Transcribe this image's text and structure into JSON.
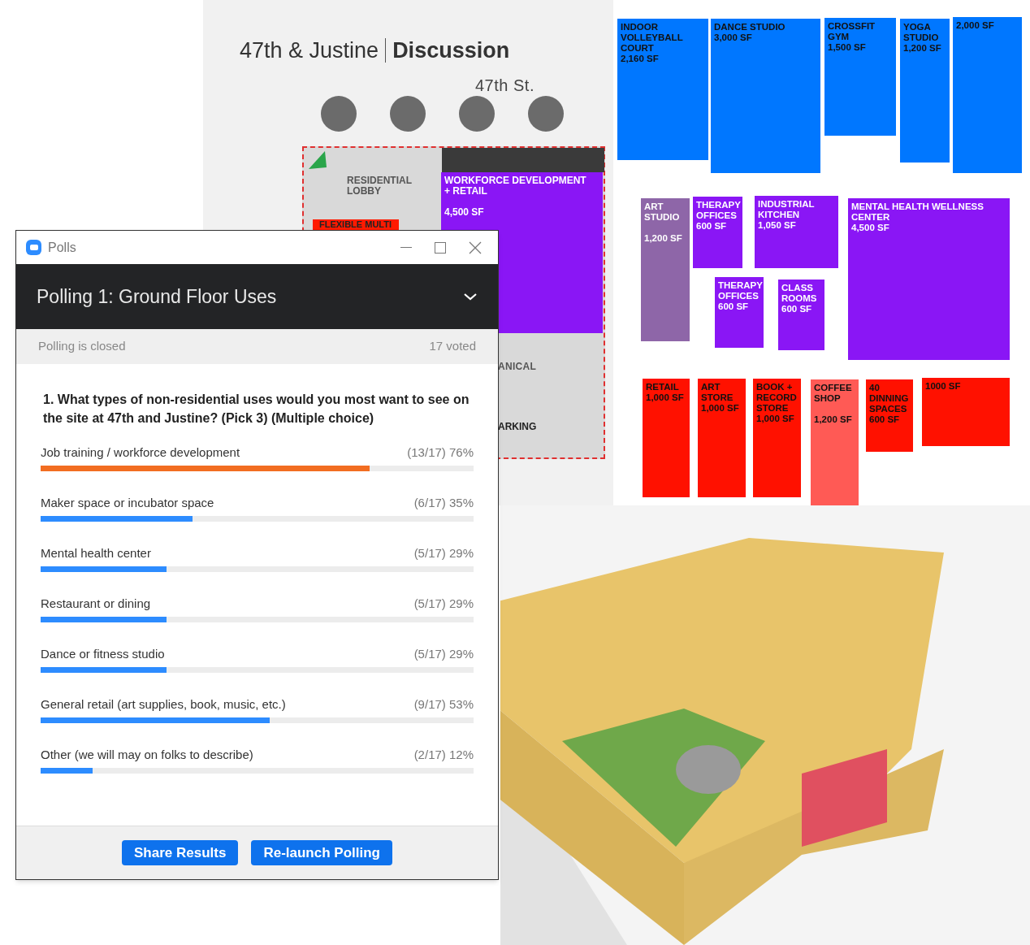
{
  "site_plan_slide": {
    "title": "47th & Justine",
    "title_bold": "Discussion",
    "street": "47th St.",
    "labels": [
      {
        "kind": "lobby",
        "text": "RESIDENTIAL LOBBY"
      },
      {
        "kind": "flex",
        "text": "FLEXIBLE MULTI"
      },
      {
        "kind": "workforce",
        "lines": [
          "WORKFORCE DEVELOPMENT",
          "+ RETAIL",
          "4,500 SF"
        ]
      },
      {
        "kind": "mech",
        "text": "ANICAL"
      },
      {
        "kind": "parking",
        "text": "ARKING"
      }
    ]
  },
  "fitness_blocks": [
    {
      "lines": [
        "INDOOR",
        "VOLLEYBALL",
        "COURT",
        "2,160 SF"
      ],
      "color": "#0077ff"
    },
    {
      "lines": [
        "DANCE STUDIO",
        "3,000 SF"
      ],
      "color": "#0077ff"
    },
    {
      "lines": [
        "CROSSFIT",
        "GYM",
        "1,500 SF"
      ],
      "color": "#0077ff"
    },
    {
      "lines": [
        "YOGA",
        "STUDIO",
        "1,200 SF"
      ],
      "color": "#0077ff"
    },
    {
      "lines": [
        "2,000 SF"
      ],
      "color": "#0077ff"
    }
  ],
  "community_blocks": [
    {
      "lines": [
        "ART",
        "STUDIO",
        "1,200 SF"
      ],
      "color": "#8e66a8",
      "gap_before_area": true
    },
    {
      "lines": [
        "THERAPY",
        "OFFICES",
        "600 SF"
      ],
      "color": "#8a16f5"
    },
    {
      "lines": [
        "INDUSTRIAL",
        "KITCHEN",
        "1,050 SF"
      ],
      "color": "#8a16f5"
    },
    {
      "lines": [
        "MENTAL HEALTH WELLNESS",
        "CENTER",
        "4,500 SF"
      ],
      "color": "#8a16f5"
    },
    {
      "lines": [
        "THERAPY",
        "OFFICES",
        "600 SF"
      ],
      "color": "#8a16f5"
    },
    {
      "lines": [
        "CLASS",
        "ROOMS",
        "600 SF"
      ],
      "color": "#8a16f5"
    }
  ],
  "retail_blocks": [
    {
      "lines": [
        "RETAIL",
        "1,000 SF"
      ],
      "color": "#ff1100"
    },
    {
      "lines": [
        "ART",
        "STORE",
        "1,000 SF"
      ],
      "color": "#ff1100"
    },
    {
      "lines": [
        "BOOK +",
        "RECORD",
        "STORE",
        "1,000 SF"
      ],
      "color": "#ff1100"
    },
    {
      "lines": [
        "COFFEE",
        "SHOP",
        "1,200 SF"
      ],
      "color": "#ff5a55",
      "gap_before_area": true
    },
    {
      "lines": [
        "40",
        "DINNING",
        "SPACES",
        "600 SF"
      ],
      "color": "#ff1100"
    },
    {
      "lines": [
        "1000 SF"
      ],
      "color": "#ff1100"
    }
  ],
  "polls_window": {
    "title": "Polls",
    "poll_title": "Polling 1: Ground Floor Uses",
    "status": "Polling is closed",
    "voted": "17 voted",
    "question": "1. What types of non-residential uses would you most want to see on the site at 47th and Justine? (Pick 3) (Multiple choice)",
    "options": [
      {
        "label": "Job training / workforce development",
        "result": "(13/17) 76%",
        "level": 0.76,
        "highlighted": true
      },
      {
        "label": "Maker space or incubator space",
        "result": "(6/17) 35%",
        "level": 0.35,
        "highlighted": false
      },
      {
        "label": "Mental health center",
        "result": "(5/17) 29%",
        "level": 0.29,
        "highlighted": false
      },
      {
        "label": "Restaurant or dining",
        "result": "(5/17) 29%",
        "level": 0.29,
        "highlighted": false
      },
      {
        "label": "Dance or fitness studio",
        "result": "(5/17) 29%",
        "level": 0.29,
        "highlighted": false
      },
      {
        "label": "General retail (art supplies, book, music, etc.)",
        "result": "(9/17) 53%",
        "level": 0.53,
        "highlighted": false
      },
      {
        "label": "Other (we will may on folks to describe)",
        "result": "(2/17) 12%",
        "level": 0.12,
        "highlighted": false
      }
    ],
    "buttons": [
      "Share Results",
      "Re-launch Polling"
    ]
  }
}
